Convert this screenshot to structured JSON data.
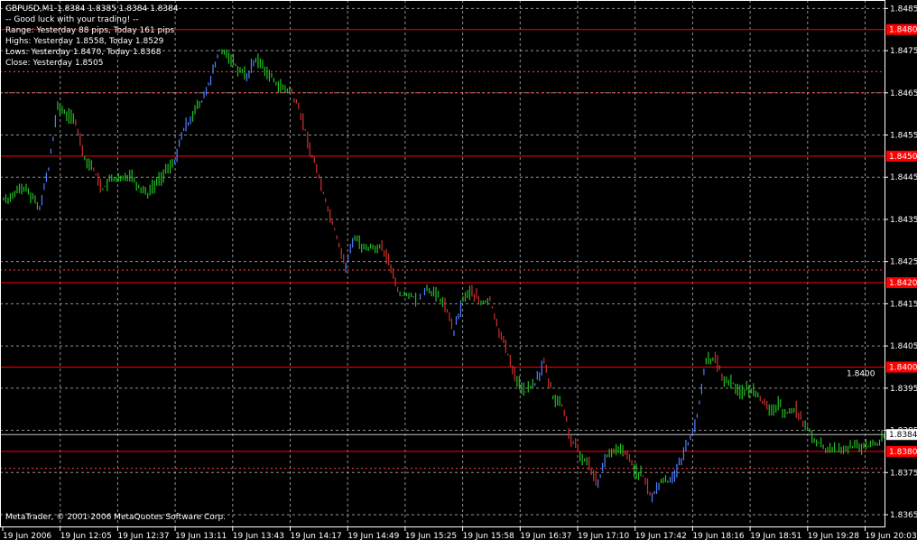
{
  "info": {
    "symbol_line": "GBPUSD,M1  1.8384 1.8385 1.8384 1.8384",
    "greeting": "-- Good luck with your trading! --",
    "range": "Range: Yesterday 88 pips, Today 161 pips",
    "highs": "Highs: Yesterday 1.8558, Today 1.8529",
    "lows": "Lows:  Yesterday 1.8470, Today 1.8368",
    "close": "Close: Yesterday 1.8505"
  },
  "copyright": "MetaTrader, © 2001-2006 MetaQuotes Software Corp.",
  "colors": {
    "background": "#000000",
    "grid": "#c0c0c0",
    "bull": "#4f7fff",
    "bear": "#d03030",
    "neutral": "#20c020",
    "level_line": "#ff0000",
    "dotted_line": "#ff4040",
    "price_line": "#c0c0c0"
  },
  "chart_data": {
    "type": "line",
    "title": "GBPUSD,M1",
    "ylim": [
      1.8362,
      1.8487
    ],
    "y_ticks": [
      "1.8485",
      "1.8475",
      "1.8465",
      "1.8455",
      "1.8445",
      "1.8435",
      "1.8425",
      "1.8415",
      "1.8405",
      "1.8395",
      "1.8385",
      "1.8375",
      "1.8365"
    ],
    "x_ticks": [
      "19 Jun 2006",
      "19 Jun 12:05",
      "19 Jun 12:37",
      "19 Jun 13:11",
      "19 Jun 13:43",
      "19 Jun 14:17",
      "19 Jun 14:49",
      "19 Jun 15:25",
      "19 Jun 15:58",
      "19 Jun 16:37",
      "19 Jun 17:10",
      "19 Jun 17:42",
      "19 Jun 18:16",
      "19 Jun 18:51",
      "19 Jun 19:28",
      "19 Jun 20:03"
    ],
    "levels": [
      {
        "price": 1.848,
        "label": "1.8480"
      },
      {
        "price": 1.845,
        "label": "1.8450"
      },
      {
        "price": 1.842,
        "label": "1.8420"
      },
      {
        "price": 1.84,
        "label": "1.8400"
      },
      {
        "price": 1.838,
        "label": "1.8380"
      }
    ],
    "dotted_levels": [
      1.847,
      1.8465,
      1.8423,
      1.8376
    ],
    "current_price": {
      "price": 1.8384,
      "label": "1.8384"
    },
    "annotation": {
      "price": 1.84,
      "label": "1.8400"
    },
    "series": [
      {
        "values": [
          1.844,
          1.8443,
          1.8441,
          1.8438,
          1.8447,
          1.8462,
          1.846,
          1.8458,
          1.845,
          1.8447,
          1.8442,
          1.8445,
          1.8444,
          1.8446,
          1.8443,
          1.8441,
          1.8444,
          1.8446,
          1.8449,
          1.8456,
          1.846,
          1.8463,
          1.8468,
          1.8475,
          1.8474,
          1.8471,
          1.8469,
          1.8473,
          1.8471,
          1.8468,
          1.8466,
          1.8465,
          1.846,
          1.8452,
          1.8445,
          1.8438,
          1.8431,
          1.8424,
          1.8431,
          1.8428,
          1.8429,
          1.8428,
          1.8424,
          1.8417,
          1.8417,
          1.8416,
          1.8419,
          1.8417,
          1.8415,
          1.8408,
          1.8416,
          1.8418,
          1.8415,
          1.8416,
          1.8409,
          1.8403,
          1.8397,
          1.8394,
          1.8396,
          1.8401,
          1.8393,
          1.8391,
          1.8383,
          1.8379,
          1.8377,
          1.8373,
          1.8379,
          1.838,
          1.838,
          1.8376,
          1.8374,
          1.8369,
          1.8373,
          1.8373,
          1.8377,
          1.8382,
          1.8388,
          1.8402,
          1.8402,
          1.8397,
          1.8396,
          1.8394,
          1.8395,
          1.8393,
          1.8389,
          1.8391,
          1.8389,
          1.839,
          1.8386,
          1.8383,
          1.8381,
          1.838,
          1.838,
          1.8381,
          1.8381,
          1.8381,
          1.8382,
          1.8384
        ]
      }
    ]
  }
}
